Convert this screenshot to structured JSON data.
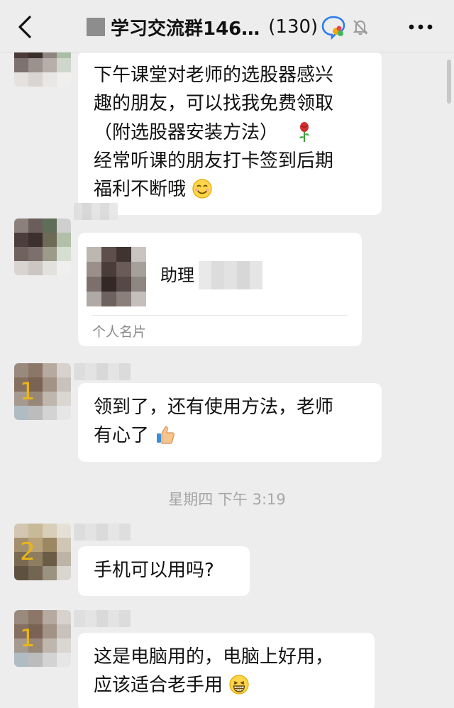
{
  "header": {
    "title": "学习交流群146…",
    "member_count": "(130)"
  },
  "messages": [
    {
      "lines": [
        "下午课堂对老师的选股器感兴",
        "趣的朋友，可以找我免费领取",
        "（附选股器安装方法）",
        "经常听课的朋友打卡签到后期",
        "福利不断哦"
      ]
    },
    {
      "card_name": "助理",
      "card_type": "个人名片"
    },
    {
      "avatar_number": "1",
      "lines": [
        "领到了，还有使用方法，老师",
        "有心了"
      ]
    },
    {
      "avatar_number": "2",
      "lines": [
        "手机可以用吗?"
      ]
    },
    {
      "avatar_number": "1",
      "lines": [
        "这是电脑用的，电脑上好用，",
        "应该适合老手用"
      ]
    }
  ],
  "timestamp": "星期四 下午 3:19",
  "colors": {
    "background": "#ededed",
    "bubble": "#ffffff",
    "avatar_number": "#e9b616",
    "timestamp": "#a6a6a6"
  }
}
